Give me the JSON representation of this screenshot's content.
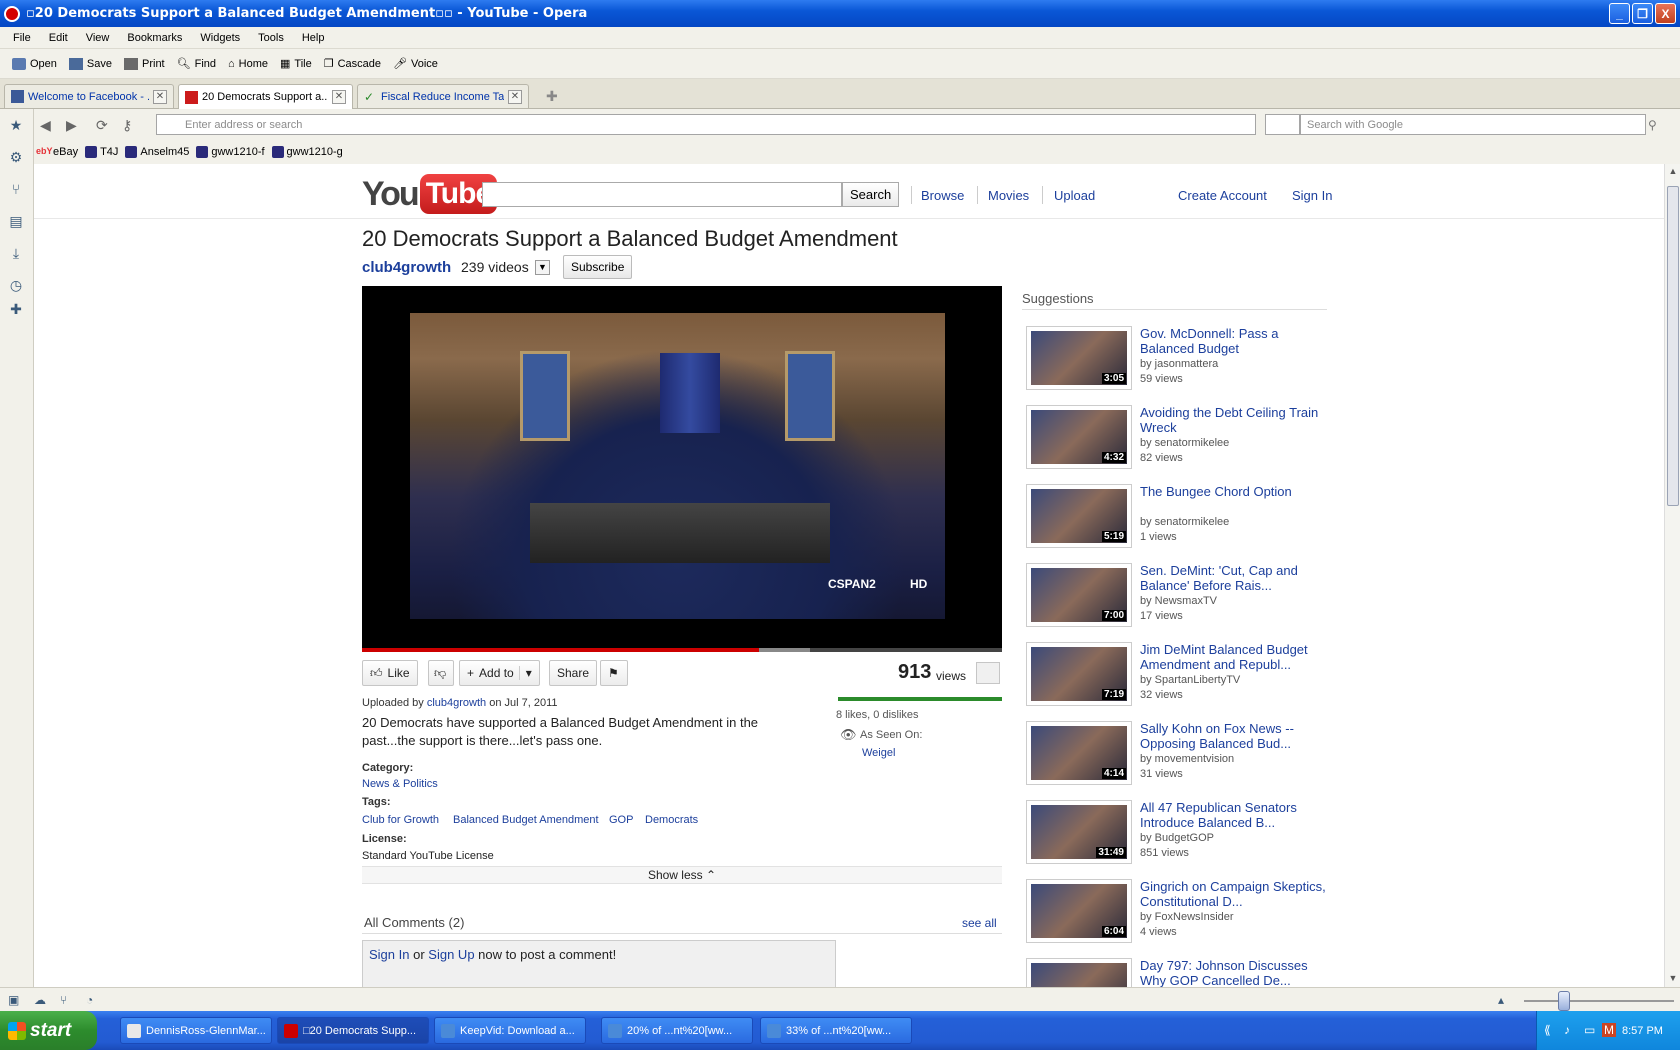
{
  "window": {
    "title": "▫20 Democrats Support a Balanced Budget Amendment▫▫ - YouTube - Opera",
    "buttons": [
      "_",
      "❐",
      "X"
    ]
  },
  "menu": [
    "File",
    "Edit",
    "View",
    "Bookmarks",
    "Widgets",
    "Tools",
    "Help"
  ],
  "toolbar": [
    "Open",
    "Save",
    "Print",
    "Find",
    "Home",
    "Tile",
    "Cascade",
    "Voice"
  ],
  "tabs": [
    {
      "label": "Welcome to Facebook - ...",
      "active": false
    },
    {
      "label": "20 Democrats Support a...",
      "active": true
    },
    {
      "label": "Fiscal Reduce Income Ta...",
      "active": false
    }
  ],
  "address": {
    "placeholder": "Enter address or search",
    "search_placeholder": "Search with Google"
  },
  "bookmarks": [
    "eBay",
    "T4J",
    "Anselm45",
    "gww1210-f",
    "gww1210-g"
  ],
  "youtube": {
    "logo_you": "You",
    "logo_tube": "Tube",
    "search_button": "Search",
    "nav": [
      "Browse",
      "Movies",
      "Upload"
    ],
    "create_account": "Create Account",
    "sign_in": "Sign In"
  },
  "video": {
    "title": "20 Democrats Support a Balanced Budget Amendment",
    "channel": "club4growth",
    "video_count": "239 videos",
    "subscribe": "Subscribe",
    "overlay_network": "CSPAN2",
    "overlay_hd": "HD",
    "progress_played_pct": 62,
    "progress_loaded_pct": 70,
    "like": "Like",
    "add_to": "Add to",
    "share": "Share",
    "views": "913",
    "views_label": "views",
    "likes_text": "8 likes, 0 dislikes",
    "as_seen_on": "As Seen On:",
    "as_seen_on_link": "Weigel",
    "uploaded_prefix": "Uploaded by",
    "uploader": "club4growth",
    "uploaded_suffix": "on Jul 7, 2011",
    "description": "20 Democrats have supported a Balanced Budget Amendment in the past...the support is there...let's pass one.",
    "category_label": "Category:",
    "category": "News & Politics",
    "tags_label": "Tags:",
    "tags": [
      "Club for Growth",
      "Balanced Budget Amendment",
      "GOP",
      "Democrats"
    ],
    "license_label": "License:",
    "license": "Standard YouTube License",
    "show_less": "Show less"
  },
  "comments": {
    "header": "All Comments (2)",
    "see_all": "see all",
    "sign_in": "Sign In",
    "or": "or",
    "sign_up": "Sign Up",
    "prompt": "now to post a comment!"
  },
  "suggestions": {
    "header": "Suggestions",
    "items": [
      {
        "title": "Gov. McDonnell: Pass a Balanced Budget",
        "by": "by jasonmattera",
        "views": "59 views",
        "duration": "3:05"
      },
      {
        "title": "Avoiding the Debt Ceiling Train Wreck",
        "by": "by senatormikelee",
        "views": "82 views",
        "duration": "4:32"
      },
      {
        "title": "The Bungee Chord Option",
        "by": "by senatormikelee",
        "views": "1 views",
        "duration": "5:19"
      },
      {
        "title": "Sen. DeMint: 'Cut, Cap and Balance' Before Rais...",
        "by": "by NewsmaxTV",
        "views": "17 views",
        "duration": "7:00"
      },
      {
        "title": "Jim DeMint Balanced Budget Amendment and Republ...",
        "by": "by SpartanLibertyTV",
        "views": "32 views",
        "duration": "7:19"
      },
      {
        "title": "Sally Kohn on Fox News -- Opposing Balanced Bud...",
        "by": "by movementvision",
        "views": "31 views",
        "duration": "4:14"
      },
      {
        "title": "All 47 Republican Senators Introduce Balanced B...",
        "by": "by BudgetGOP",
        "views": "851 views",
        "duration": "31:49"
      },
      {
        "title": "Gingrich on Campaign Skeptics, Constitutional D...",
        "by": "by FoxNewsInsider",
        "views": "4 views",
        "duration": "6:04"
      },
      {
        "title": "Day 797: Johnson Discusses Why GOP Cancelled De...",
        "by": "",
        "views": "",
        "duration": ""
      }
    ]
  },
  "taskbar": {
    "start": "start",
    "tasks": [
      {
        "label": "DennisRoss-GlennMar...",
        "active": false
      },
      {
        "label": "□20 Democrats Supp...",
        "active": true
      },
      {
        "label": "KeepVid: Download a...",
        "active": false
      },
      {
        "label": "20% of ...nt%20[ww...",
        "active": false
      },
      {
        "label": "33% of ...nt%20[ww...",
        "active": false
      }
    ],
    "clock": "8:57 PM"
  }
}
